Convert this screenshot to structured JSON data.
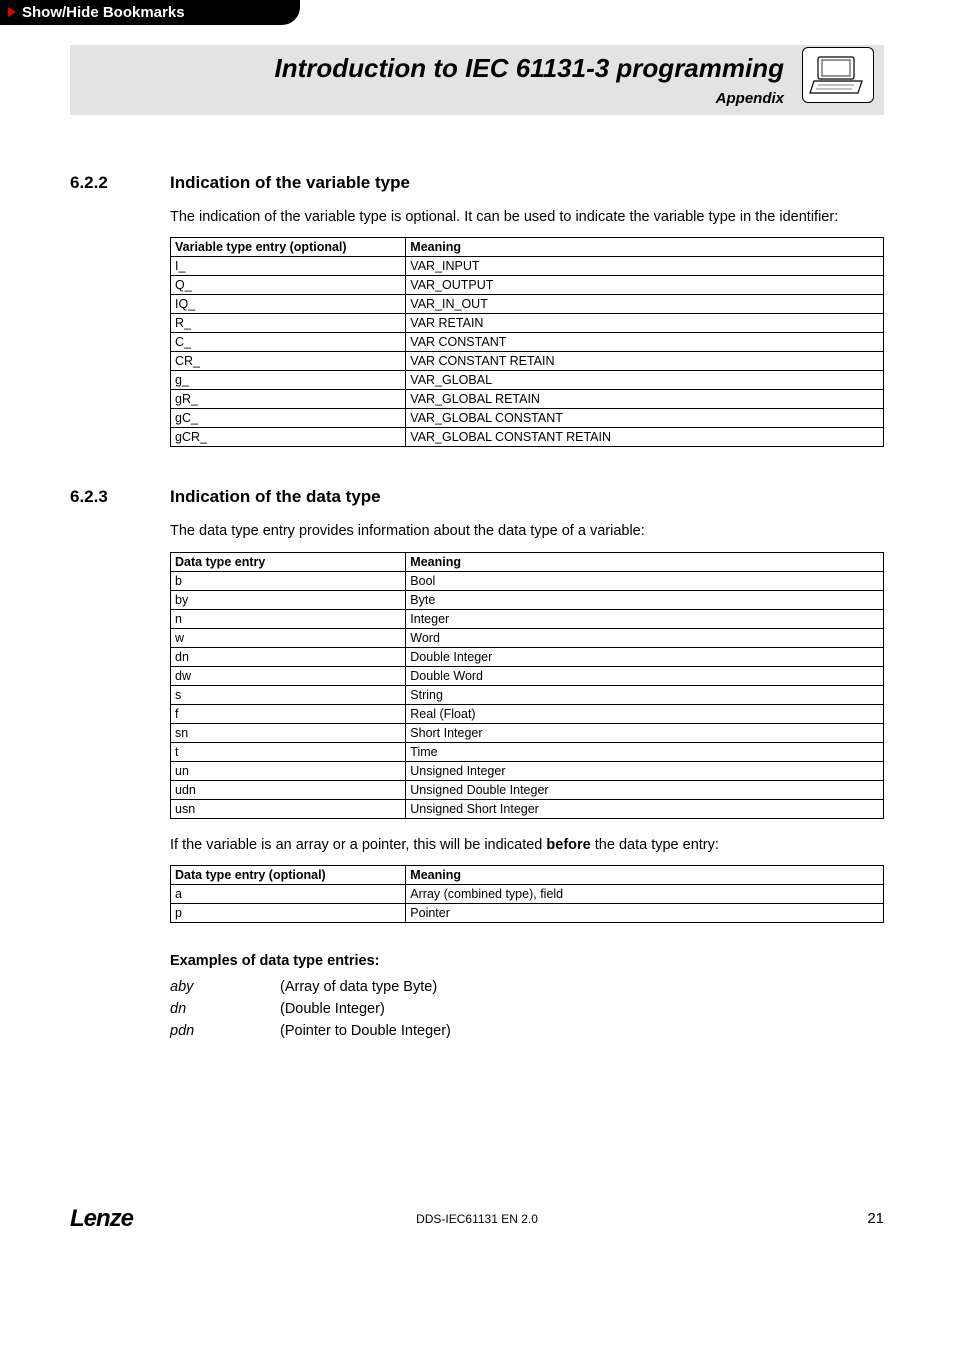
{
  "bookmark": {
    "label": "Show/Hide Bookmarks"
  },
  "header": {
    "title": "Introduction to IEC 61131-3 programming",
    "subtitle": "Appendix"
  },
  "section_622": {
    "number": "6.2.2",
    "heading": "Indication of the variable type",
    "intro": "The indication of the variable type is optional. It can be used to indicate the variable type in the identifier:",
    "table": {
      "col1": "Variable type entry (optional)",
      "col2": "Meaning",
      "rows": [
        {
          "c1": "I_",
          "c2": "VAR_INPUT"
        },
        {
          "c1": "Q_",
          "c2": "VAR_OUTPUT"
        },
        {
          "c1": "IQ_",
          "c2": "VAR_IN_OUT"
        },
        {
          "c1": "R_",
          "c2": "VAR RETAIN"
        },
        {
          "c1": "C_",
          "c2": "VAR CONSTANT"
        },
        {
          "c1": "CR_",
          "c2": "VAR CONSTANT RETAIN"
        },
        {
          "c1": "g_",
          "c2": "VAR_GLOBAL"
        },
        {
          "c1": "gR_",
          "c2": "VAR_GLOBAL RETAIN"
        },
        {
          "c1": "gC_",
          "c2": "VAR_GLOBAL CONSTANT"
        },
        {
          "c1": "gCR_",
          "c2": "VAR_GLOBAL CONSTANT RETAIN"
        }
      ]
    }
  },
  "section_623": {
    "number": "6.2.3",
    "heading": "Indication of the data type",
    "intro": "The data type entry provides information about the data type of a variable:",
    "table": {
      "col1": "Data type entry",
      "col2": "Meaning",
      "rows": [
        {
          "c1": "b",
          "c2": "Bool"
        },
        {
          "c1": "by",
          "c2": "Byte"
        },
        {
          "c1": "n",
          "c2": "Integer"
        },
        {
          "c1": "w",
          "c2": "Word"
        },
        {
          "c1": "dn",
          "c2": "Double Integer"
        },
        {
          "c1": "dw",
          "c2": "Double Word"
        },
        {
          "c1": "s",
          "c2": "String"
        },
        {
          "c1": "f",
          "c2": "Real (Float)"
        },
        {
          "c1": "sn",
          "c2": "Short Integer"
        },
        {
          "c1": "t",
          "c2": "Time"
        },
        {
          "c1": "un",
          "c2": "Unsigned Integer"
        },
        {
          "c1": "udn",
          "c2": "Unsigned Double Integer"
        },
        {
          "c1": "usn",
          "c2": "Unsigned Short Integer"
        }
      ]
    },
    "note_prefix": "If the variable is an array or a pointer, this will be indicated ",
    "note_bold": "before",
    "note_suffix": " the data type entry:",
    "table2": {
      "col1": "Data type entry (optional)",
      "col2": "Meaning",
      "rows": [
        {
          "c1": "a",
          "c2": "Array (combined type), field"
        },
        {
          "c1": "p",
          "c2": "Pointer"
        }
      ]
    },
    "examples_heading": "Examples of data type entries:",
    "examples": [
      {
        "code": "aby",
        "desc": "(Array of data type Byte)"
      },
      {
        "code": "dn",
        "desc": "(Double Integer)"
      },
      {
        "code": "pdn",
        "desc": "(Pointer to Double Integer)"
      }
    ]
  },
  "footer": {
    "brand": "Lenze",
    "doc": "DDS-IEC61131 EN 2.0",
    "page": "21"
  }
}
